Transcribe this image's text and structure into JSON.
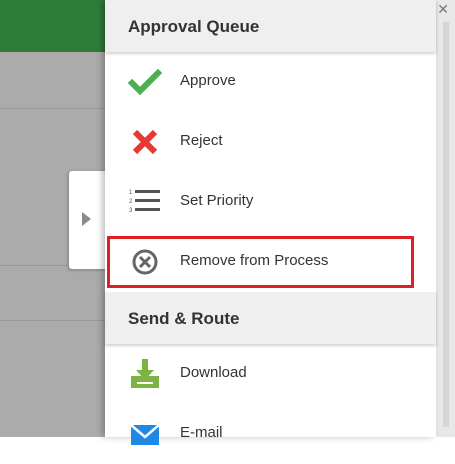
{
  "panel": {
    "sections": [
      {
        "title": "Approval Queue",
        "items": [
          {
            "label": "Approve",
            "icon": "checkmark-icon"
          },
          {
            "label": "Reject",
            "icon": "x-icon"
          },
          {
            "label": "Set Priority",
            "icon": "numbered-list-icon"
          },
          {
            "label": "Remove from Process",
            "icon": "circle-x-icon"
          }
        ]
      },
      {
        "title": "Send & Route",
        "items": [
          {
            "label": "Download",
            "icon": "download-icon"
          },
          {
            "label": "E-mail",
            "icon": "email-icon"
          }
        ]
      }
    ],
    "highlighted_item": "Remove from Process"
  },
  "colors": {
    "approve_green": "#4caf50",
    "reject_red": "#e53935",
    "highlight_red": "#e01e26",
    "header_green": "#2f7c38"
  },
  "icons": {
    "collapse": "chevron-right-icon",
    "close": "close-icon"
  }
}
